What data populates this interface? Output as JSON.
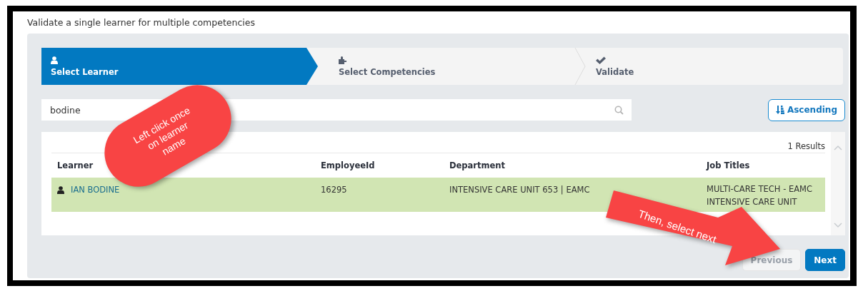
{
  "page_title": "Validate a single learner for multiple competencies",
  "steps": [
    {
      "label": "Select Learner",
      "selected": true
    },
    {
      "label": "Select Competencies",
      "selected": false
    },
    {
      "label": "Validate",
      "selected": false
    }
  ],
  "search": {
    "value": "bodine"
  },
  "sort_button": {
    "label": "Ascending"
  },
  "table": {
    "results_count": "1 Results",
    "columns": [
      "Learner",
      "EmployeeId",
      "Department",
      "Job Titles"
    ],
    "rows": [
      {
        "selected": true,
        "learner": "IAN BODINE",
        "employee_id": "16295",
        "department": "INTENSIVE CARE UNIT 653 | EAMC",
        "job_titles": [
          "MULTI-CARE TECH - EAMC",
          "INTENSIVE CARE UNIT"
        ]
      }
    ]
  },
  "buttons": [
    {
      "label": "Previous",
      "kind": "default",
      "disabled": true
    },
    {
      "label": "Next",
      "kind": "primary",
      "disabled": false
    }
  ],
  "annotations": [
    {
      "kind": "bubble",
      "text": "Left click once on learner name"
    },
    {
      "kind": "arrow",
      "text": "Then, select next"
    }
  ]
}
